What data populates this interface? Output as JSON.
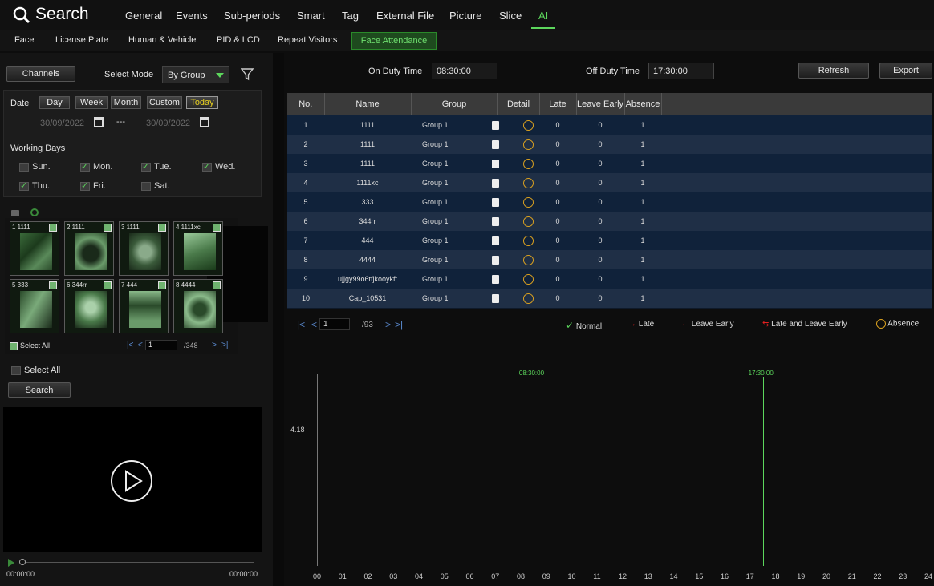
{
  "header": {
    "title": "Search",
    "tabs": [
      "General",
      "Events",
      "Sub-periods",
      "Smart",
      "Tag",
      "External File",
      "Picture",
      "Slice",
      "AI"
    ],
    "active_tab": "AI"
  },
  "subtabs": {
    "items": [
      "Face",
      "License Plate",
      "Human & Vehicle",
      "PID & LCD",
      "Repeat Visitors",
      "Face Attendance"
    ],
    "active": "Face Attendance"
  },
  "left": {
    "channels_label": "Channels",
    "select_mode_label": "Select Mode",
    "select_mode_value": "By Group",
    "date_label": "Date",
    "date_tabs": [
      "Day",
      "Week",
      "Month",
      "Custom",
      "Today"
    ],
    "date_active": "Today",
    "date_from": "30/09/2022",
    "date_to": "30/09/2022",
    "date_sep": "---",
    "working_days_label": "Working Days",
    "days": [
      {
        "label": "Sun.",
        "checked": false
      },
      {
        "label": "Mon.",
        "checked": true
      },
      {
        "label": "Tue.",
        "checked": true
      },
      {
        "label": "Wed.",
        "checked": true
      },
      {
        "label": "Thu.",
        "checked": true
      },
      {
        "label": "Fri.",
        "checked": true
      },
      {
        "label": "Sat.",
        "checked": false
      }
    ],
    "thumbs": [
      "1 1111",
      "2 1111",
      "3 1111",
      "4 1111xc",
      "5 333",
      "6 344rr",
      "7 444",
      "8 4444"
    ],
    "thumb_select_all": "Select All",
    "thumb_page": "1",
    "thumb_total": "/348",
    "select_all": "Select All",
    "search_btn": "Search",
    "time_start": "00:00:00",
    "time_end": "00:00:00"
  },
  "toolbar": {
    "on_duty_label": "On Duty Time",
    "on_duty_value": "08:30:00",
    "off_duty_label": "Off Duty Time",
    "off_duty_value": "17:30:00",
    "refresh": "Refresh",
    "export": "Export"
  },
  "table": {
    "columns": [
      "No.",
      "Name",
      "Group",
      "Detail",
      "Late",
      "Leave Early",
      "Absence"
    ],
    "rows": [
      [
        "1",
        "1111",
        "Group 1",
        "0",
        "0",
        "1"
      ],
      [
        "2",
        "1111",
        "Group 1",
        "0",
        "0",
        "1"
      ],
      [
        "3",
        "1111",
        "Group 1",
        "0",
        "0",
        "1"
      ],
      [
        "4",
        "1111xc",
        "Group 1",
        "0",
        "0",
        "1"
      ],
      [
        "5",
        "333",
        "Group 1",
        "0",
        "0",
        "1"
      ],
      [
        "6",
        "344rr",
        "Group 1",
        "0",
        "0",
        "1"
      ],
      [
        "7",
        "444",
        "Group 1",
        "0",
        "0",
        "1"
      ],
      [
        "8",
        "4444",
        "Group 1",
        "0",
        "0",
        "1"
      ],
      [
        "9",
        "ujjgy99o6tfjkooykft",
        "Group 1",
        "0",
        "0",
        "1"
      ],
      [
        "10",
        "Cap_10531",
        "Group 1",
        "0",
        "0",
        "1"
      ]
    ],
    "page": "1",
    "total_pages": "/93"
  },
  "legend": {
    "normal": "Normal",
    "late": "Late",
    "leave_early": "Leave Early",
    "late_and_leave_early": "Late and Leave Early",
    "absence": "Absence"
  },
  "colors": {
    "accent": "#5cd65c",
    "late": "#e02020",
    "absence": "#d9a020"
  },
  "chart_data": {
    "type": "line",
    "x_ticks": [
      "00",
      "01",
      "02",
      "03",
      "04",
      "05",
      "06",
      "07",
      "08",
      "09",
      "10",
      "11",
      "12",
      "13",
      "14",
      "15",
      "16",
      "17",
      "18",
      "19",
      "20",
      "21",
      "22",
      "23",
      "24"
    ],
    "y_tick": "4.18",
    "markers": [
      {
        "label": "08:30:00",
        "x": 8.5
      },
      {
        "label": "17:30:00",
        "x": 17.5
      }
    ],
    "xlim": [
      0,
      24
    ]
  }
}
